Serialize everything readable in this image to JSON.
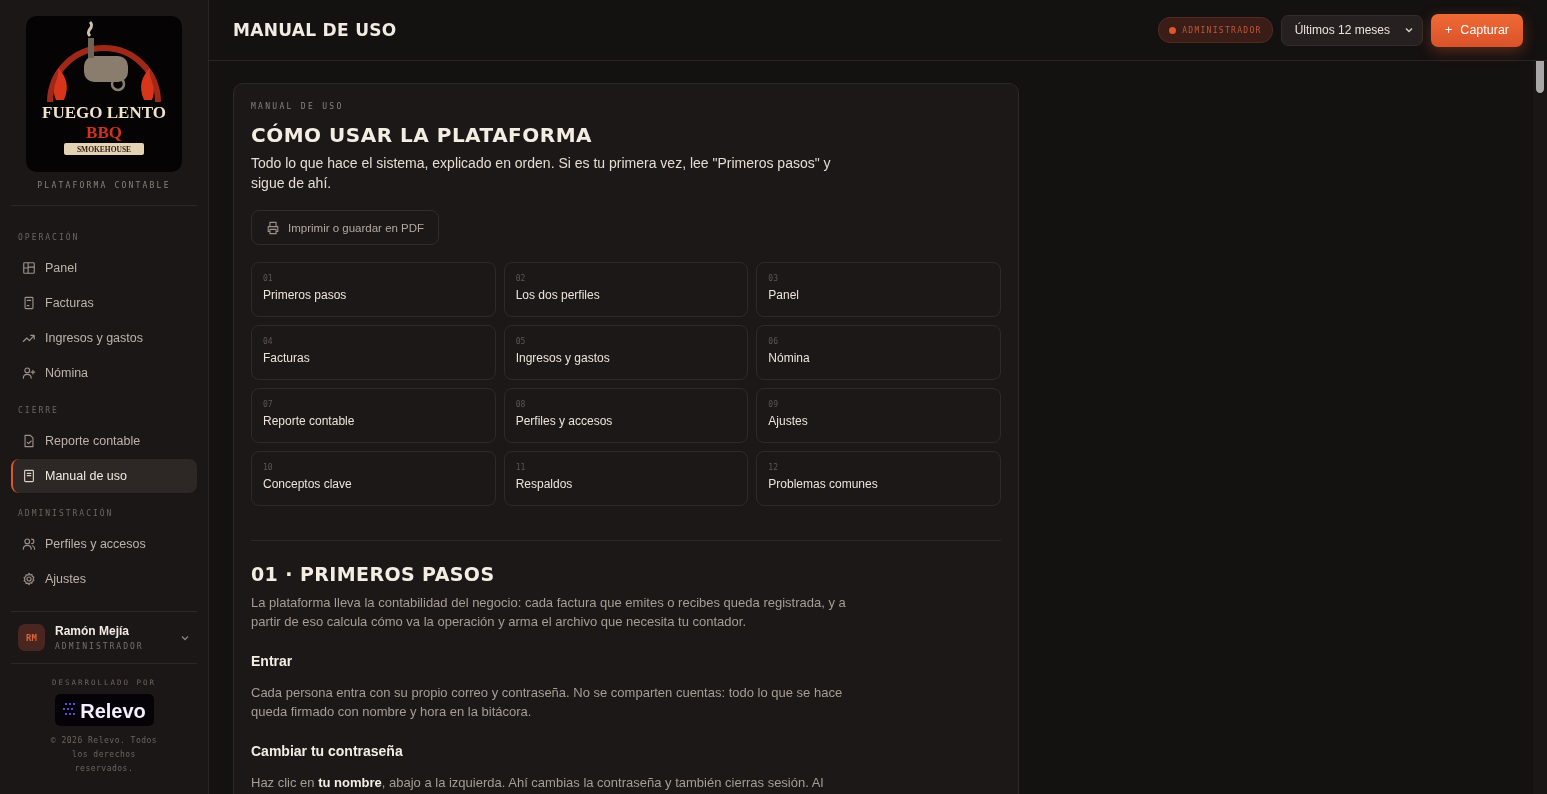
{
  "sidebar": {
    "logo": {
      "name": "FUEGO LENTO",
      "sub": "BBQ",
      "tag": "SMOKEHOUSE"
    },
    "subtitle": "PLATAFORMA CONTABLE",
    "sections": [
      {
        "title": "OPERACIÓN",
        "items": [
          {
            "label": "Panel",
            "selected": false
          },
          {
            "label": "Facturas",
            "selected": false
          },
          {
            "label": "Ingresos y gastos",
            "selected": false
          },
          {
            "label": "Nómina",
            "selected": false
          }
        ]
      },
      {
        "title": "CIERRE",
        "items": [
          {
            "label": "Reporte contable",
            "selected": false
          },
          {
            "label": "Manual de uso",
            "selected": true
          }
        ]
      },
      {
        "title": "ADMINISTRACIÓN",
        "items": [
          {
            "label": "Perfiles y accesos",
            "selected": false
          },
          {
            "label": "Ajustes",
            "selected": false
          }
        ]
      }
    ],
    "user": {
      "initials": "RM",
      "name": "Ramón Mejía",
      "role": "ADMINISTRADOR"
    },
    "footer": {
      "label": "DESARROLLADO POR",
      "brand": "Relevo",
      "copyright": "© 2026 Relevo. Todos los derechos reservados."
    }
  },
  "topbar": {
    "title": "MANUAL DE USO",
    "role_badge": "ADMINISTRADOR",
    "period": "Últimos 12 meses",
    "action_icon": "+",
    "action": "Capturar"
  },
  "manual": {
    "eyebrow": "MANUAL DE USO",
    "title": "CÓMO USAR LA PLATAFORMA",
    "intro": "Todo lo que hace el sistema, explicado en orden. Si es tu primera vez, lee \"Primeros pasos\" y sigue de ahí.",
    "print_button": "Imprimir o guardar en PDF",
    "topics": [
      {
        "number": "01",
        "label": "Primeros pasos"
      },
      {
        "number": "02",
        "label": "Los dos perfiles"
      },
      {
        "number": "03",
        "label": "Panel"
      },
      {
        "number": "04",
        "label": "Facturas"
      },
      {
        "number": "05",
        "label": "Ingresos y gastos"
      },
      {
        "number": "06",
        "label": "Nómina"
      },
      {
        "number": "07",
        "label": "Reporte contable"
      },
      {
        "number": "08",
        "label": "Perfiles y accesos"
      },
      {
        "number": "09",
        "label": "Ajustes"
      },
      {
        "number": "10",
        "label": "Conceptos clave"
      },
      {
        "number": "11",
        "label": "Respaldos"
      },
      {
        "number": "12",
        "label": "Problemas comunes"
      }
    ],
    "section": {
      "title": "01 · PRIMEROS PASOS",
      "blocks": [
        {
          "kind": "paragraph",
          "text": "La plataforma lleva la contabilidad del negocio: cada factura que emites o recibes queda registrada, y a partir de eso calcula cómo va la operación y arma el archivo que necesita tu contador."
        },
        {
          "kind": "heading",
          "text": "Entrar"
        },
        {
          "kind": "paragraph",
          "text": "Cada persona entra con su propio correo y contraseña. No se comparten cuentas: todo lo que se hace queda firmado con nombre y hora en la bitácora."
        },
        {
          "kind": "heading",
          "text": "Cambiar tu contraseña"
        },
        {
          "kind": "paragraph",
          "text": "Haz clic en **tu nombre**, abajo a la izquierda. Ahí cambias la contraseña y también cierras sesión. Al"
        }
      ]
    }
  }
}
